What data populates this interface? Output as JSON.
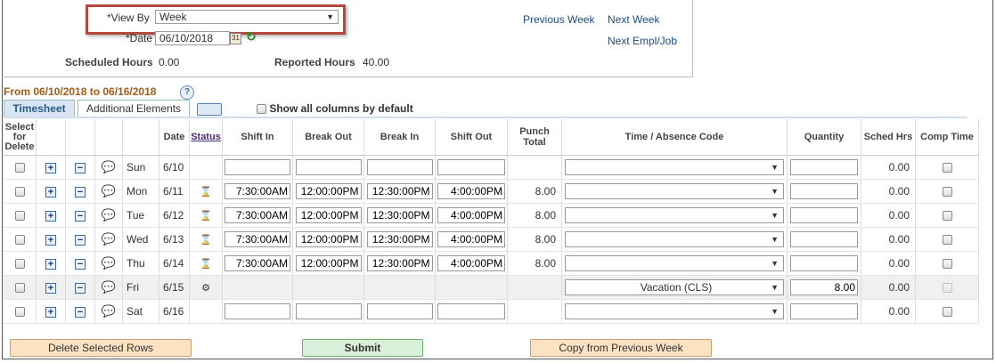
{
  "header": {
    "view_by_label": "*View By",
    "view_by_value": "Week",
    "date_label": "*Date",
    "date_value": "06/10/2018",
    "scheduled_hours_label": "Scheduled Hours",
    "scheduled_hours_value": "0.00",
    "reported_hours_label": "Reported Hours",
    "reported_hours_value": "40.00",
    "previous_week_link": "Previous Week",
    "next_week_link": "Next Week",
    "next_empl_job_link": "Next Empl/Job"
  },
  "period_title": "From 06/10/2018 to 06/16/2018",
  "help_icon": "?",
  "tabs": [
    {
      "label": "Timesheet"
    },
    {
      "label": "Additional Elements"
    }
  ],
  "show_all_label": "Show all columns by default",
  "columns": {
    "select": "Select for Delete",
    "date": "Date",
    "status": "Status",
    "shift_in": "Shift In",
    "break_out": "Break Out",
    "break_in": "Break In",
    "shift_out": "Shift Out",
    "punch_total": "Punch Total",
    "code": "Time / Absence Code",
    "quantity": "Quantity",
    "sched_hrs": "Sched Hrs",
    "comp_time": "Comp Time"
  },
  "rows": [
    {
      "day": "Sun",
      "date": "6/10",
      "status_icon": "",
      "shift_in": "",
      "break_out": "",
      "break_in": "",
      "shift_out": "",
      "punch_total": "",
      "code": "",
      "quantity": "",
      "sched_hrs": "0.00"
    },
    {
      "day": "Mon",
      "date": "6/11",
      "status_icon": "hourglass-icon",
      "shift_in": "7:30:00AM",
      "break_out": "12:00:00PM",
      "break_in": "12:30:00PM",
      "shift_out": "4:00:00PM",
      "punch_total": "8.00",
      "code": "",
      "quantity": "",
      "sched_hrs": "0.00"
    },
    {
      "day": "Tue",
      "date": "6/12",
      "status_icon": "hourglass-icon",
      "shift_in": "7:30:00AM",
      "break_out": "12:00:00PM",
      "break_in": "12:30:00PM",
      "shift_out": "4:00:00PM",
      "punch_total": "8.00",
      "code": "",
      "quantity": "",
      "sched_hrs": "0.00"
    },
    {
      "day": "Wed",
      "date": "6/13",
      "status_icon": "hourglass-icon",
      "shift_in": "7:30:00AM",
      "break_out": "12:00:00PM",
      "break_in": "12:30:00PM",
      "shift_out": "4:00:00PM",
      "punch_total": "8.00",
      "code": "",
      "quantity": "",
      "sched_hrs": "0.00"
    },
    {
      "day": "Thu",
      "date": "6/14",
      "status_icon": "hourglass-icon",
      "shift_in": "7:30:00AM",
      "break_out": "12:00:00PM",
      "break_in": "12:30:00PM",
      "shift_out": "4:00:00PM",
      "punch_total": "8.00",
      "code": "",
      "quantity": "",
      "sched_hrs": "0.00"
    },
    {
      "day": "Fri",
      "date": "6/15",
      "status_icon": "gears-icon",
      "shift_in": "",
      "break_out": "",
      "break_in": "",
      "shift_out": "",
      "punch_total": "",
      "code": "Vacation (CLS)",
      "quantity": "8.00",
      "sched_hrs": "0.00"
    },
    {
      "day": "Sat",
      "date": "6/16",
      "status_icon": "",
      "shift_in": "",
      "break_out": "",
      "break_in": "",
      "shift_out": "",
      "punch_total": "",
      "code": "",
      "quantity": "",
      "sched_hrs": "0.00"
    }
  ],
  "buttons": {
    "delete": "Delete Selected Rows",
    "submit": "Submit",
    "copy": "Copy from Previous Week"
  },
  "colors": {
    "highlight_border": "#b24a3c",
    "title": "#a65a1a",
    "link": "#1a4a8a"
  }
}
